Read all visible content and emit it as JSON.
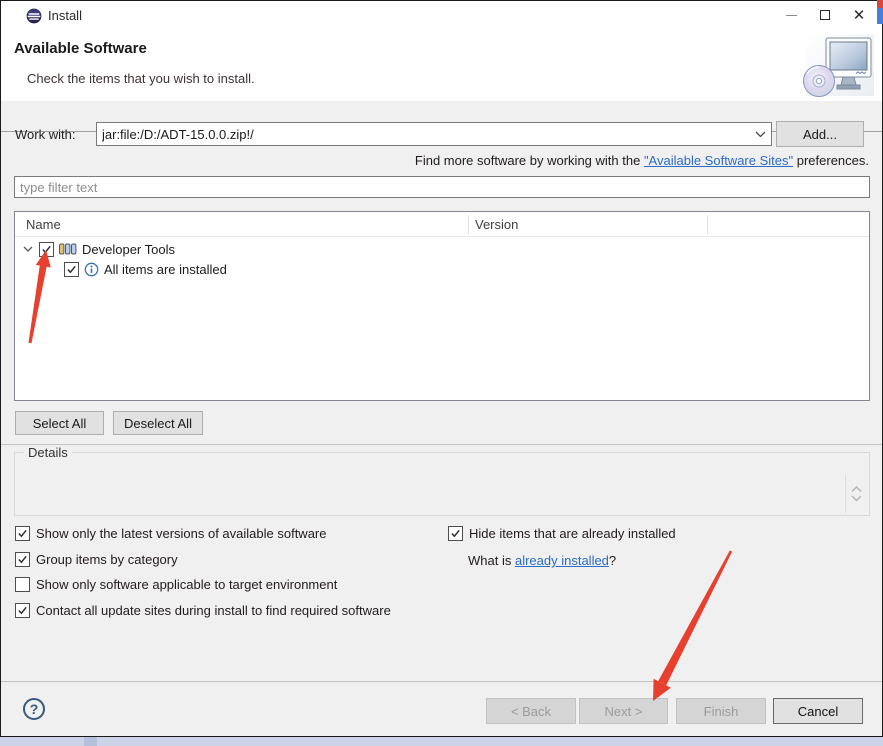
{
  "colors": {
    "arrow_red": "#e8402f",
    "link_blue": "#2b6cc4",
    "body_gray": "#f0f0f0"
  },
  "icons": {
    "app": "eclipse-logo",
    "minimize": "thin-dash",
    "maximize": "hollow-square",
    "close": "✕",
    "combo_chevron": "chevron-down",
    "tree_expanded": "chevron-down",
    "category": "three-pillars",
    "info": "circled-i",
    "wizard_graphic": "monitor-with-cd",
    "help": "circled-question"
  },
  "titlebar": {
    "title": "Install"
  },
  "header": {
    "title": "Available Software",
    "description": "Check the items that you wish to install."
  },
  "work_with": {
    "label": "Work with:",
    "value": "jar:file:/D:/ADT-15.0.0.zip!/",
    "add_button": "Add...",
    "hint_prefix": "Find more software by working with the ",
    "hint_link": "\"Available Software Sites\"",
    "hint_suffix": " preferences."
  },
  "filter": {
    "placeholder": "type filter text"
  },
  "tree": {
    "columns": [
      {
        "label": "Name"
      },
      {
        "label": "Version"
      }
    ],
    "rows": [
      {
        "label": "Developer Tools",
        "checked": true,
        "expanded": true
      },
      {
        "label": "All items are installed",
        "checked": true
      }
    ]
  },
  "actions": {
    "select_all": "Select All",
    "deselect_all": "Deselect All"
  },
  "details": {
    "label": "Details"
  },
  "options": {
    "left": [
      {
        "label": "Show only the latest versions of available software",
        "checked": true
      },
      {
        "label": "Group items by category",
        "checked": true
      },
      {
        "label": "Show only software applicable to target environment",
        "checked": false
      },
      {
        "label": "Contact all update sites during install to find required software",
        "checked": true
      }
    ],
    "right": [
      {
        "label": "Hide items that are already installed",
        "checked": true
      }
    ],
    "what_is": {
      "prefix": "What is ",
      "link": "already installed",
      "suffix": "?"
    }
  },
  "footer": {
    "help": "?",
    "back": "< Back",
    "next": "Next >",
    "finish": "Finish",
    "cancel": "Cancel"
  }
}
